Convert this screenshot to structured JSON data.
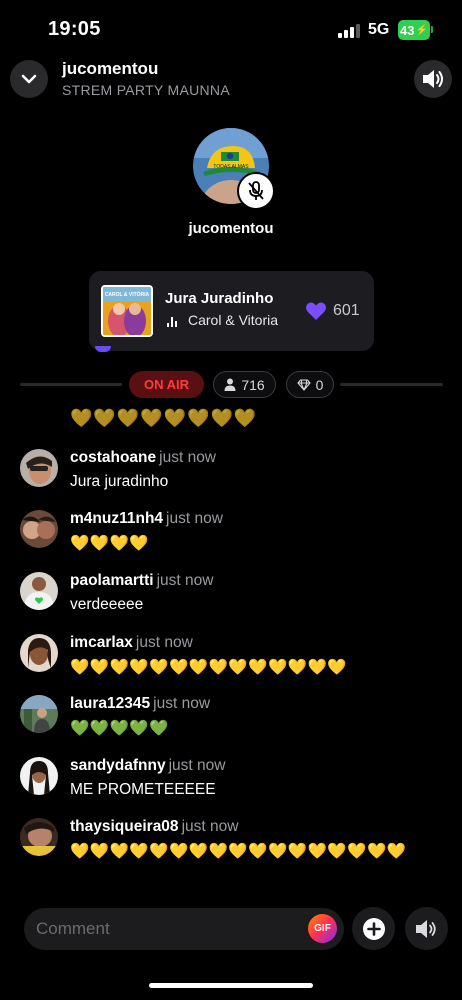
{
  "status_bar": {
    "time": "19:05",
    "network": "5G",
    "battery": "43"
  },
  "header": {
    "title": "jucomentou",
    "subtitle": "STREM PARTY MAUNNA"
  },
  "host": {
    "name": "jucomentou",
    "hat_text": "TODAS ALMAS"
  },
  "now_playing": {
    "title": "Jura Juradinho",
    "artist": "Carol & Vitoria",
    "likes": "601",
    "album_text": "CAROL & VITÓRIA"
  },
  "live_bar": {
    "on_air": "ON AIR",
    "listeners": "716",
    "gems": "0"
  },
  "comments": [
    {
      "user": "costahoane",
      "time": "just now",
      "text": "Jura juradinho"
    },
    {
      "user": "m4nuz11nh4",
      "time": "just now",
      "text": "💛💛💛💛"
    },
    {
      "user": "paolamartti",
      "time": "just now",
      "text": "verdeeeee"
    },
    {
      "user": "imcarlax",
      "time": "just now",
      "text": "💛💛💛💛💛💛💛💛💛💛💛💛💛💛"
    },
    {
      "user": "laura12345",
      "time": "just now",
      "text": "💚💚💚💚💚"
    },
    {
      "user": "sandydafnny",
      "time": "just now",
      "text": "ME PROMETEEEEE"
    },
    {
      "user": "thaysiqueira08",
      "time": "just now",
      "text": "💛💛💛💛💛💛💛💛💛💛💛💛💛💛💛💛💛"
    }
  ],
  "partial_row": "💛💛💛💛💛💛💛💛",
  "composer": {
    "placeholder": "Comment",
    "gif_label": "GIF"
  },
  "colors": {
    "accent": "#6b4bf5",
    "on_air": "#ff3b3b",
    "battery": "#2fcf4f"
  }
}
